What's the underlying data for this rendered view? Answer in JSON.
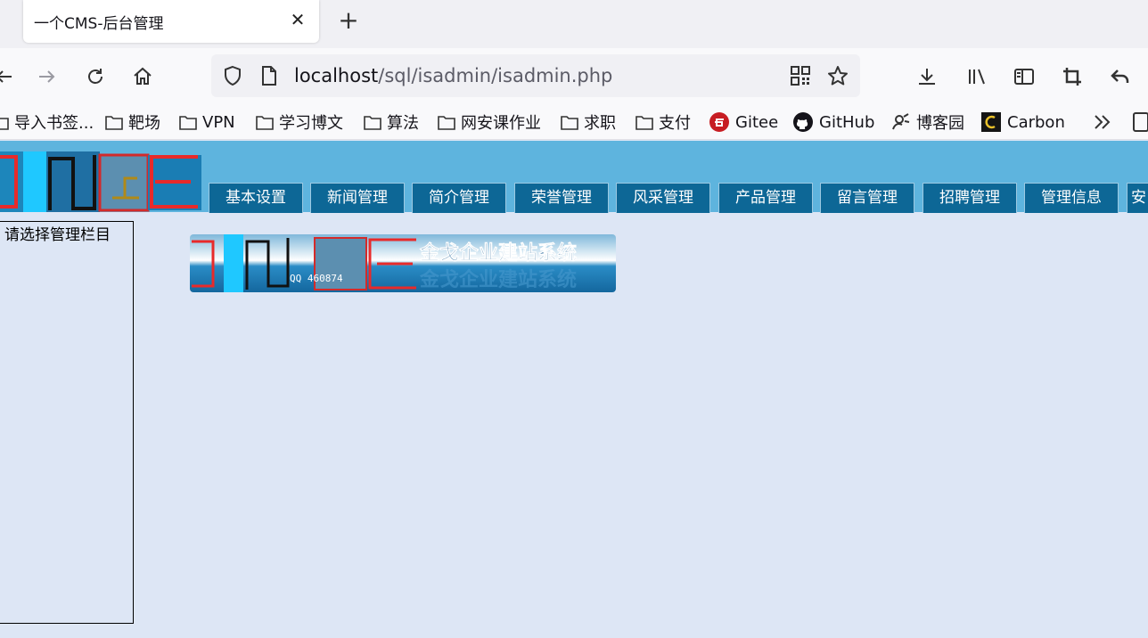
{
  "browser": {
    "tab_title": "一个CMS-后台管理",
    "close_glyph": "✕",
    "new_tab_glyph": "+",
    "url_host": "localhost",
    "url_path": "/sql/isadmin/isadmin.php"
  },
  "bookmarks": [
    {
      "label": "导入书签...",
      "icon": "folder-icon"
    },
    {
      "label": "靶场",
      "icon": "folder-icon"
    },
    {
      "label": "VPN",
      "icon": "folder-icon"
    },
    {
      "label": "学习博文",
      "icon": "folder-icon"
    },
    {
      "label": "算法",
      "icon": "folder-icon"
    },
    {
      "label": "网安课作业",
      "icon": "folder-icon"
    },
    {
      "label": "求职",
      "icon": "folder-icon"
    },
    {
      "label": "支付",
      "icon": "folder-icon"
    },
    {
      "label": "Gitee",
      "icon": "gitee-icon"
    },
    {
      "label": "GitHub",
      "icon": "github-icon"
    },
    {
      "label": "博客园",
      "icon": "cnblogs-icon"
    },
    {
      "label": "Carbon",
      "icon": "carbon-icon"
    }
  ],
  "menu": [
    "基本设置",
    "新闻管理",
    "简介管理",
    "荣誉管理",
    "风采管理",
    "产品管理",
    "留言管理",
    "招聘管理",
    "管理信息",
    "安"
  ],
  "sidebar": {
    "prompt": "请选择管理栏目"
  },
  "banner": {
    "title": "金戈企业建站系统",
    "qq": "QQ 460874"
  },
  "colors": {
    "header": "#5eb4de",
    "menu_tab": "#0d6796",
    "page_bg": "#dde6f5"
  }
}
